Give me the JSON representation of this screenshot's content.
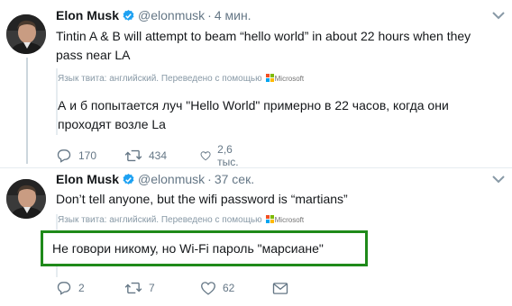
{
  "tweets": [
    {
      "author_name": "Elon Musk",
      "handle": "@elonmusk",
      "separator": "·",
      "time": "4 мин.",
      "text": "Tintin A & B will attempt to beam “hello world” in about 22 hours when they pass near LA",
      "translation_meta": "Язык твита: английский. Переведено с помощью",
      "translator": "Microsoft",
      "translation": "А и б попытается луч \"Hello World\" примерно в 22 часов, когда они проходят возле La",
      "replies": "170",
      "retweets": "434",
      "likes": "2,6 тыс."
    },
    {
      "author_name": "Elon Musk",
      "handle": "@elonmusk",
      "separator": "·",
      "time": "37 сек.",
      "text": "Don’t tell anyone, but the wifi password is “martians”",
      "translation_meta": "Язык твита: английский. Переведено с помощью",
      "translator": "Microsoft",
      "translation": "Не говори никому, но Wi-Fi пароль \"марсиане\"",
      "replies": "2",
      "retweets": "7",
      "likes": "62"
    }
  ],
  "colors": {
    "verified": "#1da1f2",
    "highlight_border": "#1f8a1a",
    "muted": "#657786"
  },
  "icons": [
    "verified-badge-icon",
    "chevron-down-icon",
    "microsoft-logo-icon",
    "reply-icon",
    "retweet-icon",
    "like-icon",
    "direct-message-icon"
  ]
}
